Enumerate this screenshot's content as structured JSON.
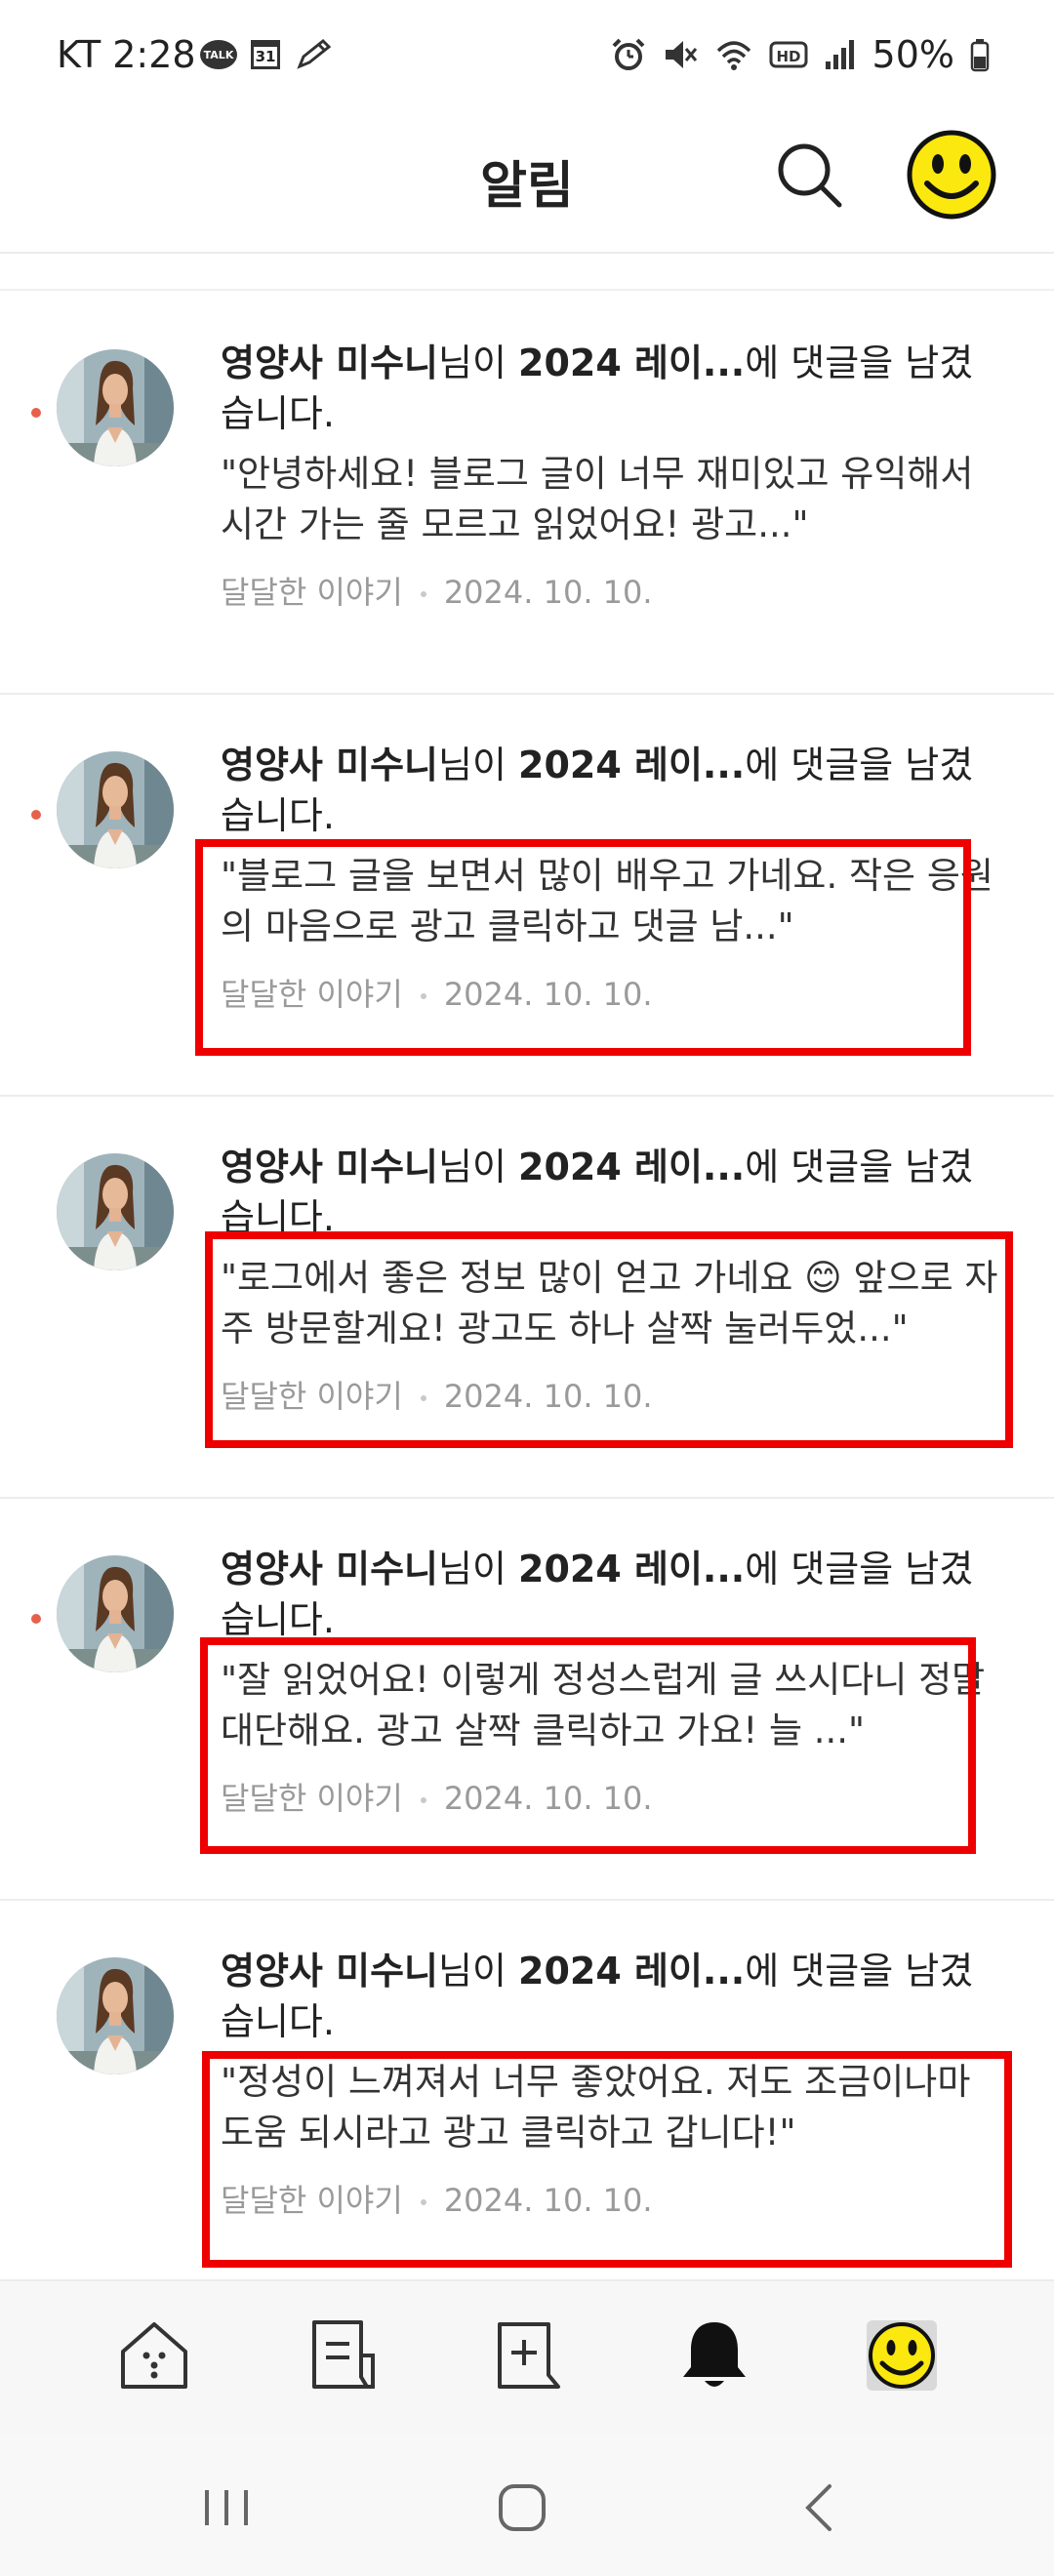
{
  "status_bar": {
    "time": "KT 2:28",
    "talk_badge": "TALK",
    "calendar_day": "31",
    "battery": "50%",
    "icons": [
      "talk-icon",
      "calendar-icon",
      "pencil-icon",
      "alarm-icon",
      "mute-icon",
      "wifi-icon",
      "hd-icon",
      "signal-icon",
      "battery-icon"
    ]
  },
  "header": {
    "title": "알림",
    "icons": [
      "search-icon",
      "smiley-profile-icon"
    ]
  },
  "notifications": [
    {
      "author": "영양사 미수니",
      "suffix": "님이",
      "post": "2024 레이...",
      "action": "에 댓글을 남겼습니다.",
      "quote": "\"안녕하세요! 블로그 글이 너무 재미있고 유익해서 시간 가는 줄 모르고 읽었어요! 광고...\"",
      "blog": "달달한 이야기",
      "date": "2024. 10. 10.",
      "unread": true
    },
    {
      "author": "영양사 미수니",
      "suffix": "님이",
      "post": "2024 레이...",
      "action": "에 댓글을 남겼습니다.",
      "quote": "\"블로그 글을 보면서 많이 배우고 가네요. 작은 응원의 마음으로 광고 클릭하고 댓글 남...\"",
      "blog": "달달한 이야기",
      "date": "2024. 10. 10.",
      "unread": true
    },
    {
      "author": "영양사 미수니",
      "suffix": "님이",
      "post": "2024 레이...",
      "action": "에 댓글을 남겼습니다.",
      "quote": "\"로그에서 좋은 정보 많이 얻고 가네요 😊 앞으로 자주 방문할게요! 광고도 하나 살짝 눌러두었...\"",
      "blog": "달달한 이야기",
      "date": "2024. 10. 10.",
      "unread": false
    },
    {
      "author": "영양사 미수니",
      "suffix": "님이",
      "post": "2024 레이...",
      "action": "에 댓글을 남겼습니다.",
      "quote": "\"잘 읽었어요! 이렇게 정성스럽게 글 쓰시다니 정말 대단해요. 광고 살짝 클릭하고 가요! 늘 ...\"",
      "blog": "달달한 이야기",
      "date": "2024. 10. 10.",
      "unread": true
    },
    {
      "author": "영양사 미수니",
      "suffix": "님이",
      "post": "2024 레이...",
      "action": "에 댓글을 남겼습니다.",
      "quote": "\"정성이 느껴져서 너무 좋았어요. 저도 조금이나마 도움 되시라고 광고 클릭하고 갑니다!\"",
      "blog": "달달한 이야기",
      "date": "2024. 10. 10.",
      "unread": false
    }
  ],
  "annotation_color": "#ee0000",
  "bottom_nav": {
    "items": [
      "home-icon",
      "post-list-icon",
      "new-post-icon",
      "bell-icon",
      "smiley-profile-icon"
    ],
    "active": "bell-icon"
  },
  "system_nav": [
    "recent-apps-icon",
    "home-button-icon",
    "back-icon"
  ]
}
